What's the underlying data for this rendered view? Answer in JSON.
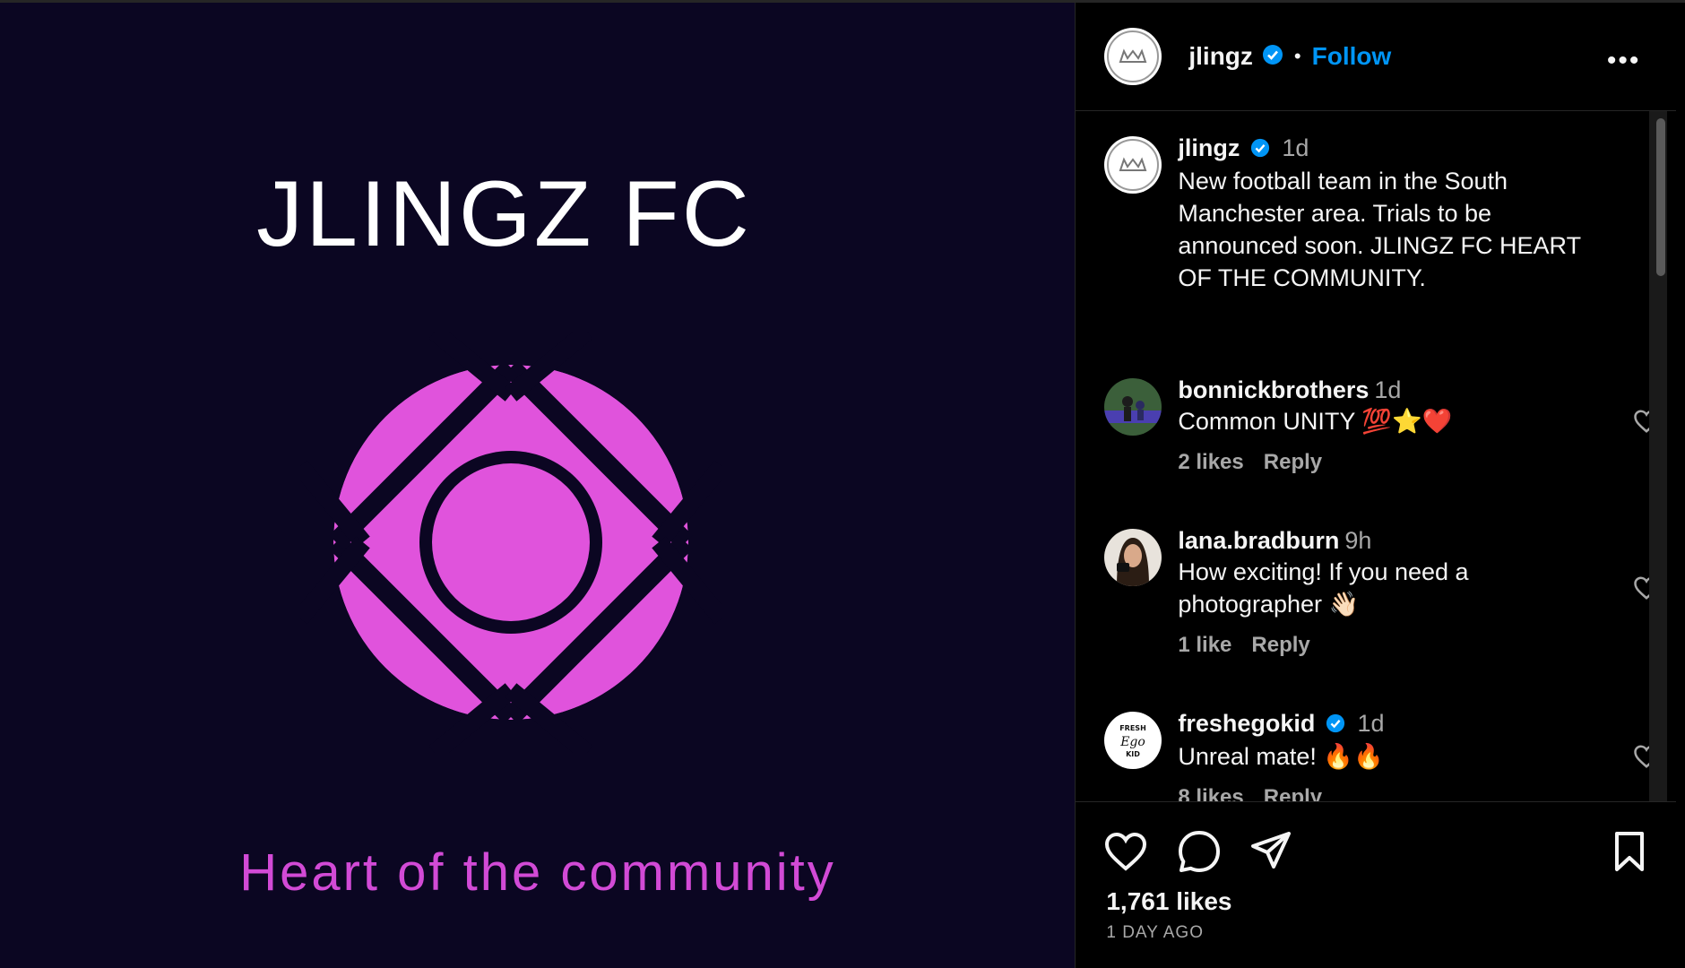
{
  "media": {
    "title": "JLINGZ FC",
    "tagline": "Heart of the community",
    "background_color": "#0b0622",
    "accent_color": "#e053dc"
  },
  "header": {
    "username": "jlingz",
    "separator": "•",
    "follow_label": "Follow",
    "more_label": "•••"
  },
  "caption": {
    "username": "jlingz",
    "time": "1d",
    "text": "New football team in the South Manchester area. Trials to be announced soon. JLINGZ FC HEART OF THE COMMUNITY."
  },
  "comments": [
    {
      "username": "bonnickbrothers",
      "time": "1d",
      "text": "Common UNITY 💯⭐❤️",
      "likes": "2 likes",
      "reply": "Reply"
    },
    {
      "username": "lana.bradburn",
      "time": "9h",
      "text": "How exciting! If you need a photographer 👋🏻",
      "likes": "1 like",
      "reply": "Reply"
    },
    {
      "username": "freshegokid",
      "time": "1d",
      "text": "Unreal mate! 🔥🔥",
      "likes": "8 likes",
      "reply": "Reply"
    }
  ],
  "footer": {
    "likes_count": "1,761 likes",
    "posted_ago": "1 DAY AGO"
  },
  "colors": {
    "link_blue": "#0095f6",
    "muted_text": "#a8a8a8"
  },
  "icons": [
    "heart-icon",
    "comment-icon",
    "share-icon",
    "bookmark-icon",
    "verified-badge-icon",
    "more-options-icon"
  ]
}
